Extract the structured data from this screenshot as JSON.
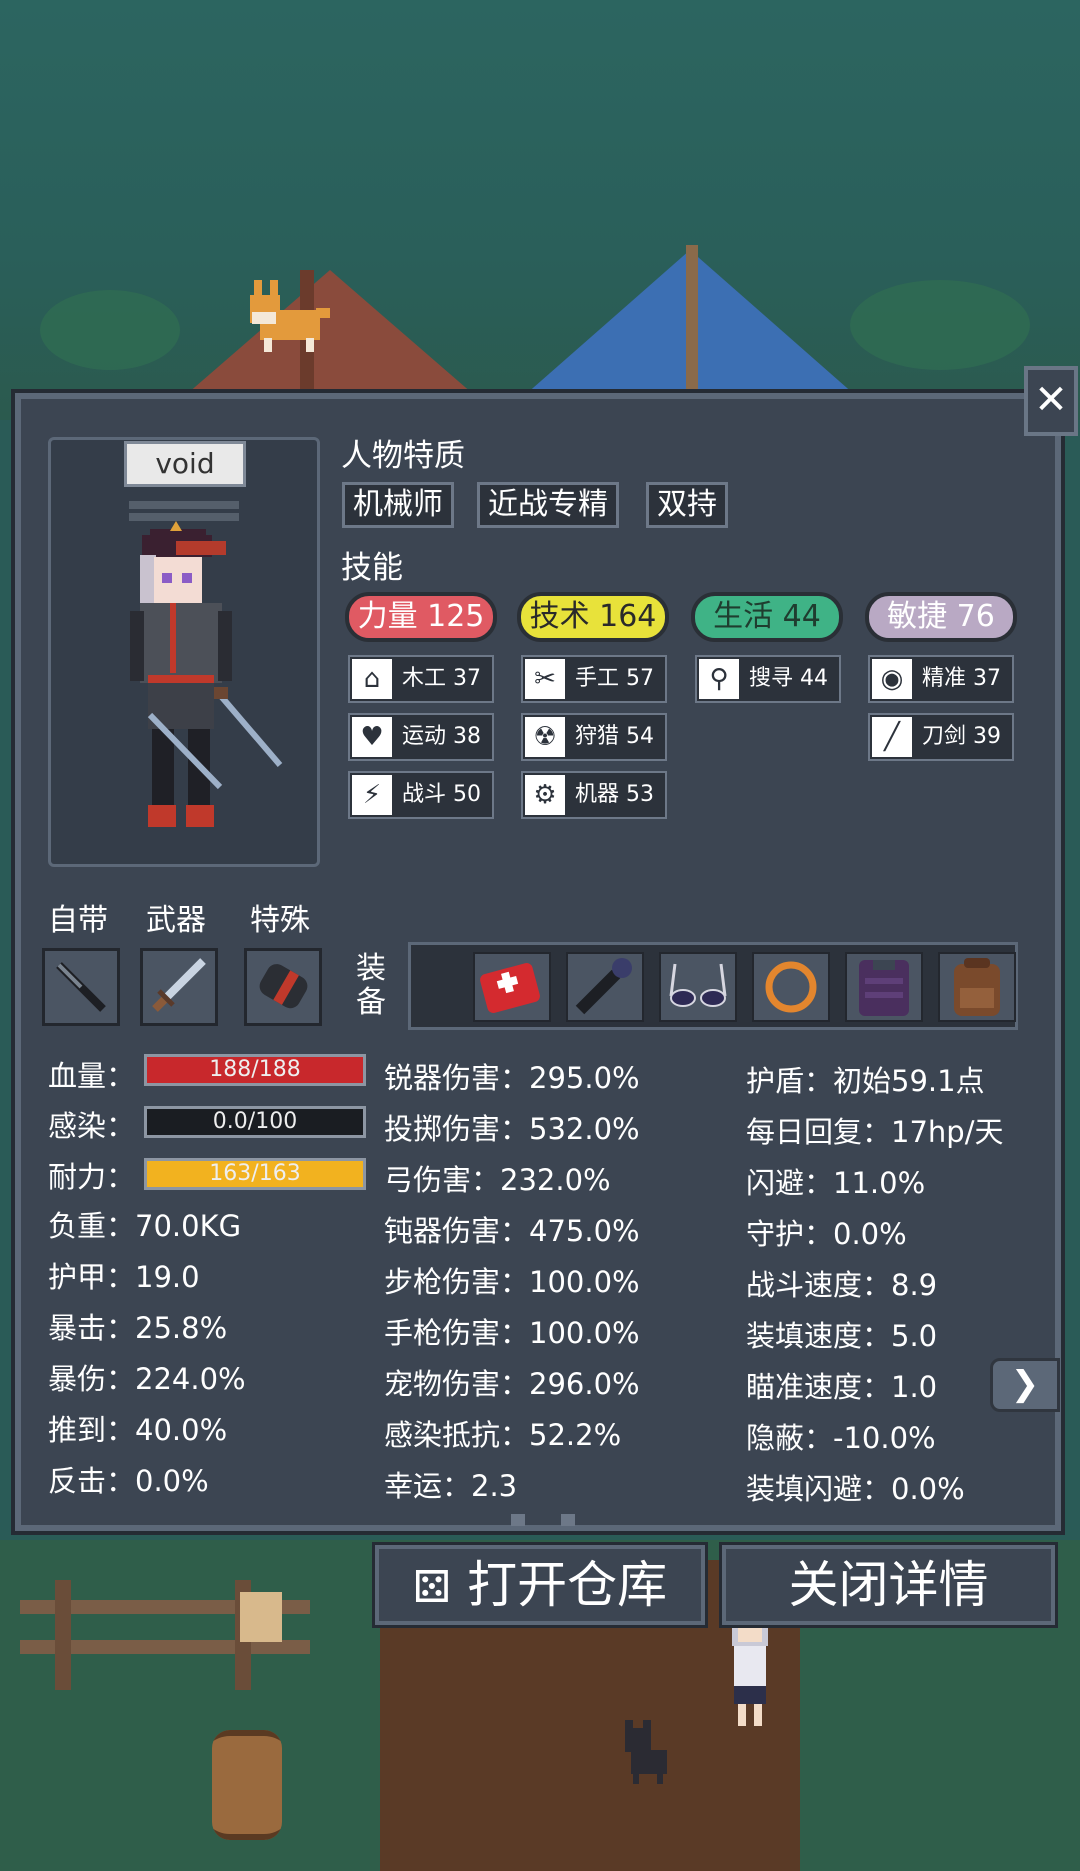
{
  "character": {
    "name": "void"
  },
  "traits": {
    "title": "人物特质",
    "items": [
      "机械师",
      "近战专精",
      "双持"
    ]
  },
  "skills": {
    "title": "技能",
    "groups": [
      {
        "label": "力量 125",
        "color": "#e05a63",
        "subs": [
          {
            "icon": "house-icon",
            "label": "木工 37"
          },
          {
            "icon": "heart-icon",
            "label": "运动 38"
          },
          {
            "icon": "fist-icon",
            "label": "战斗 50"
          }
        ]
      },
      {
        "label": "技术 164",
        "color": "#e8e23a",
        "subs": [
          {
            "icon": "scissors-icon",
            "label": "手工 57"
          },
          {
            "icon": "radiation-icon",
            "label": "狩猎 54"
          },
          {
            "icon": "gear-icon",
            "label": "机器 53"
          }
        ]
      },
      {
        "label": "生活 44",
        "color": "#3fb386",
        "subs": [
          {
            "icon": "magnifier-icon",
            "label": "搜寻 44"
          }
        ]
      },
      {
        "label": "敏捷 76",
        "color": "#b9a9c4",
        "subs": [
          {
            "icon": "eye-icon",
            "label": "精准 37"
          },
          {
            "icon": "blade-icon",
            "label": "刀剑 39"
          }
        ]
      }
    ]
  },
  "slots": {
    "labels": [
      "自带",
      "武器",
      "特殊"
    ],
    "equip_label": "装备"
  },
  "stats": {
    "hp": {
      "label": "血量：",
      "value": "188/188",
      "fraction": 1.0
    },
    "infection": {
      "label": "感染：",
      "value": "0.0/100",
      "fraction": 0.0
    },
    "stamina": {
      "label": "耐力：",
      "value": "163/163",
      "fraction": 1.0
    },
    "col1": [
      "负重：70.0KG",
      "护甲：19.0",
      "暴击：25.8%",
      "暴伤：224.0%",
      "推到：40.0%",
      "反击：0.0%"
    ],
    "col2": [
      "锐器伤害：295.0%",
      "投掷伤害：532.0%",
      "弓伤害：232.0%",
      "钝器伤害：475.0%",
      "步枪伤害：100.0%",
      "手枪伤害：100.0%",
      "宠物伤害：296.0%",
      "感染抵抗：52.2%",
      "幸运：2.3"
    ],
    "col3": [
      "护盾：初始59.1点",
      "每日回复：17hp/天",
      "闪避：11.0%",
      "守护：0.0%",
      "战斗速度：8.9",
      "装填速度：5.0",
      "瞄准速度：1.0",
      "隐蔽：-10.0%",
      "装填闪避：0.0%"
    ]
  },
  "buttons": {
    "open_storage": "打开仓库",
    "close_details": "关闭详情"
  },
  "colors": {
    "hp_fill": "#c8282c",
    "stamina_fill": "#f2b21f",
    "panel": "#3c4552"
  }
}
